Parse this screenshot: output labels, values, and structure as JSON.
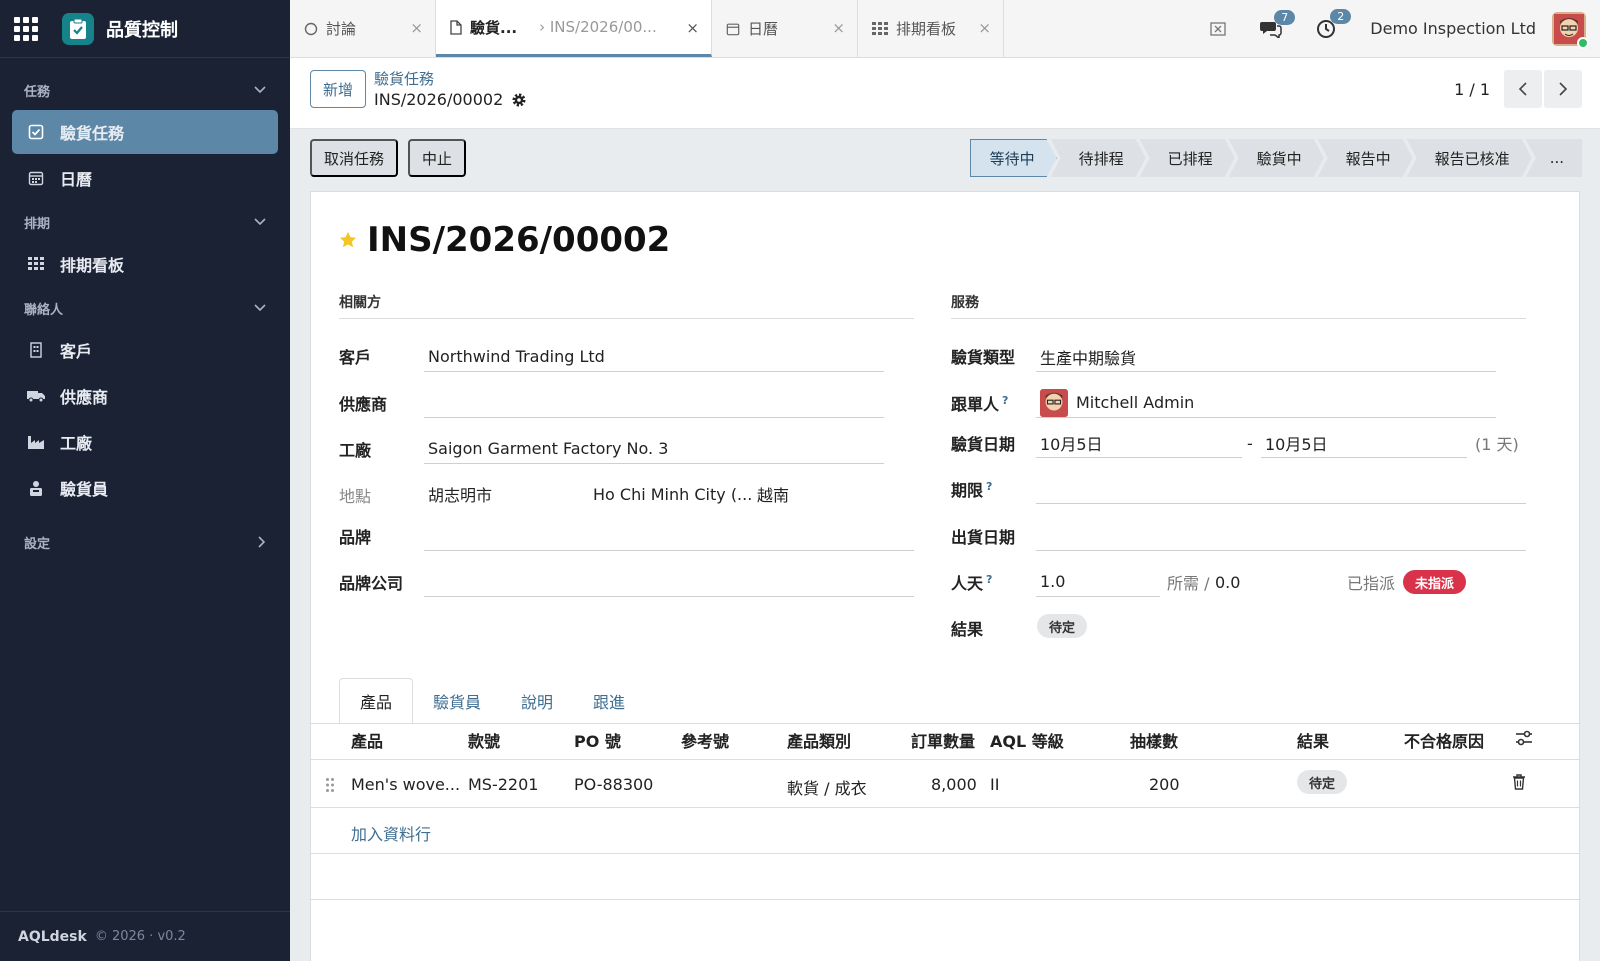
{
  "app": {
    "title": "品質控制"
  },
  "sidebar": {
    "sections": [
      {
        "label": "任務",
        "items": [
          {
            "label": "驗貨任務"
          },
          {
            "label": "日曆"
          }
        ]
      },
      {
        "label": "排期",
        "items": [
          {
            "label": "排期看板"
          }
        ]
      },
      {
        "label": "聯絡人",
        "items": [
          {
            "label": "客戶"
          },
          {
            "label": "供應商"
          },
          {
            "label": "工廠"
          },
          {
            "label": "驗貨員"
          }
        ]
      },
      {
        "label": "設定"
      }
    ],
    "footer": {
      "brand": "AQLdesk",
      "meta": "© 2026 · v0.2"
    }
  },
  "tabs": [
    {
      "label": "討論"
    },
    {
      "label": "驗貨...",
      "sub": "› INS/2026/00..."
    },
    {
      "label": "日曆"
    },
    {
      "label": "排期看板"
    }
  ],
  "topbar": {
    "messages_count": "7",
    "activities_count": "2",
    "company": "Demo Inspection Ltd"
  },
  "control": {
    "new_label": "新增",
    "breadcrumb_parent": "驗貨任務",
    "breadcrumb_current": "INS/2026/00002",
    "pager": "1 / 1"
  },
  "actions": {
    "cancel_task": "取消任務",
    "abort": "中止"
  },
  "stages": [
    "等待中",
    "待排程",
    "已排程",
    "驗貨中",
    "報告中",
    "報告已核准",
    "..."
  ],
  "record": {
    "title": "INS/2026/00002",
    "groups": {
      "parties": "相關方",
      "service": "服務"
    },
    "customer": {
      "label": "客戶",
      "value": "Northwind Trading Ltd"
    },
    "supplier": {
      "label": "供應商",
      "value": ""
    },
    "factory": {
      "label": "工廠",
      "value": "Saigon Garment Factory No. 3"
    },
    "location": {
      "label": "地點",
      "city": "胡志明市",
      "city_en": "Ho Chi Minh City (...",
      "country": "越南"
    },
    "brand": {
      "label": "品牌",
      "value": ""
    },
    "brand_company": {
      "label": "品牌公司",
      "value": ""
    },
    "inspection_type": {
      "label": "驗貨類型",
      "value": "生產中期驗貨"
    },
    "follower": {
      "label": "跟單人",
      "help": "?",
      "value": "Mitchell Admin"
    },
    "inspection_date": {
      "label": "驗貨日期",
      "from": "10月5日",
      "sep": "-",
      "to": "10月5日",
      "duration": "(1 天)"
    },
    "deadline": {
      "label": "期限",
      "help": "?",
      "value": ""
    },
    "ship_date": {
      "label": "出貨日期",
      "value": ""
    },
    "man_days": {
      "label": "人天",
      "help": "?",
      "value": "1.0",
      "required_label": "所需 /",
      "required_value": "0.0",
      "assigned_label": "已指派",
      "assigned_status": "未指派"
    },
    "result": {
      "label": "結果",
      "value": "待定"
    }
  },
  "form_tabs": [
    "產品",
    "驗貨員",
    "說明",
    "跟進"
  ],
  "products_table": {
    "columns": [
      "產品",
      "款號",
      "PO 號",
      "參考號",
      "產品類別",
      "訂單數量",
      "AQL 等級",
      "抽樣數",
      "結果",
      "不合格原因"
    ],
    "rows": [
      {
        "product": "Men's wove...",
        "style": "MS-2201",
        "po": "PO-88300",
        "ref": "",
        "category": "軟貨 / 成衣",
        "qty": "8,000",
        "aql": "II",
        "sample": "200",
        "result": "待定",
        "reason": ""
      }
    ],
    "add_line": "加入資料行"
  }
}
